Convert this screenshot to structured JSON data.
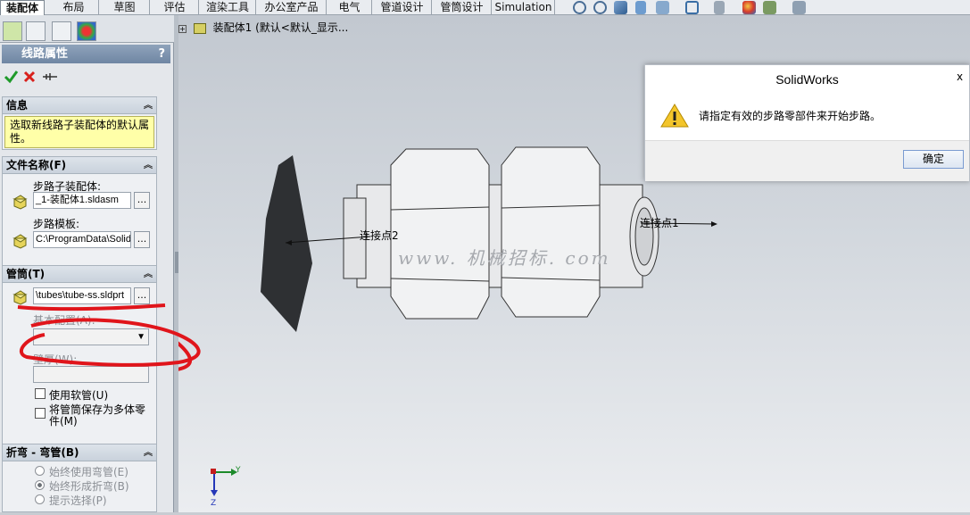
{
  "tabs": [
    "装配体",
    "布局",
    "草图",
    "评估",
    "渲染工具",
    "办公室产品",
    "电气",
    "管道设计",
    "管筒设计",
    "Simulation"
  ],
  "active_tab_index": 0,
  "tree": {
    "label": "装配体1  (默认<默认_显示..."
  },
  "panel": {
    "title": "线路属性",
    "help": "?",
    "info_section": {
      "title": "信息",
      "text": "选取新线路子装配体的默认属性。"
    },
    "file_section": {
      "title": "文件名称(F)",
      "subassembly_label": "步路子装配体:",
      "subassembly_value": "_1-装配体1.sldasm",
      "template_label": "步路模板:",
      "template_value": "C:\\ProgramData\\Solid",
      "browse": "..."
    },
    "tube_section": {
      "title": "管筒(T)",
      "tube_value": "\\tubes\\tube-ss.sldprt",
      "browse": "...",
      "base_config_label": "基本配置(A):",
      "wall_label": "壁厚(W):",
      "flex_label": "使用软管(U)",
      "multibody_label": "将管筒保存为多体零件(M)"
    },
    "bend_section": {
      "title": "折弯 - 弯管(B)",
      "options": [
        "始终使用弯管(E)",
        "始终形成折弯(B)",
        "提示选择(P)"
      ],
      "selected": 1
    }
  },
  "viewport": {
    "connection_point_1": "连接点1",
    "connection_point_2": "连接点2",
    "watermark": "www. 机械招标. com",
    "axis_y": "Y",
    "axis_z": "Z"
  },
  "dialog": {
    "title": "SolidWorks",
    "close": "x",
    "message": "请指定有效的步路零部件来开始步路。",
    "ok_label": "确定"
  },
  "colors": {
    "accent_title": "#7a8fab",
    "info_bg": "#ffffa8",
    "annotation": "#e0151b"
  }
}
